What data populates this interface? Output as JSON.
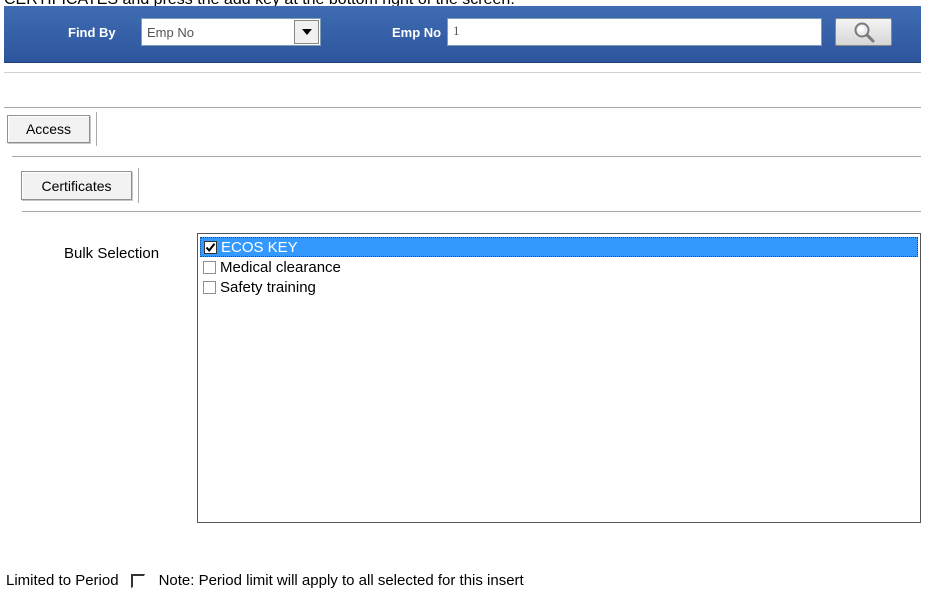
{
  "caption": "CERTIFICATES and press the add key at the bottom right of the screen.",
  "find_bar": {
    "find_by_label": "Find By",
    "find_by_value": "Emp No",
    "emp_no_label": "Emp No",
    "emp_no_value": "1",
    "search_icon": "magnifier-icon",
    "bar_color": "#3a64ab"
  },
  "tabs": {
    "access": "Access",
    "certificates": "Certificates"
  },
  "bulk_selection": {
    "label": "Bulk Selection",
    "items": [
      {
        "label": "ECOS KEY",
        "checked": true,
        "selected": true
      },
      {
        "label": "Medical clearance",
        "checked": false,
        "selected": false
      },
      {
        "label": "Safety training",
        "checked": false,
        "selected": false
      }
    ],
    "selection_color": "#3399ff"
  },
  "period": {
    "label": "Limited to Period",
    "note": "Note: Period limit will apply to all selected for this insert",
    "checked": false
  }
}
